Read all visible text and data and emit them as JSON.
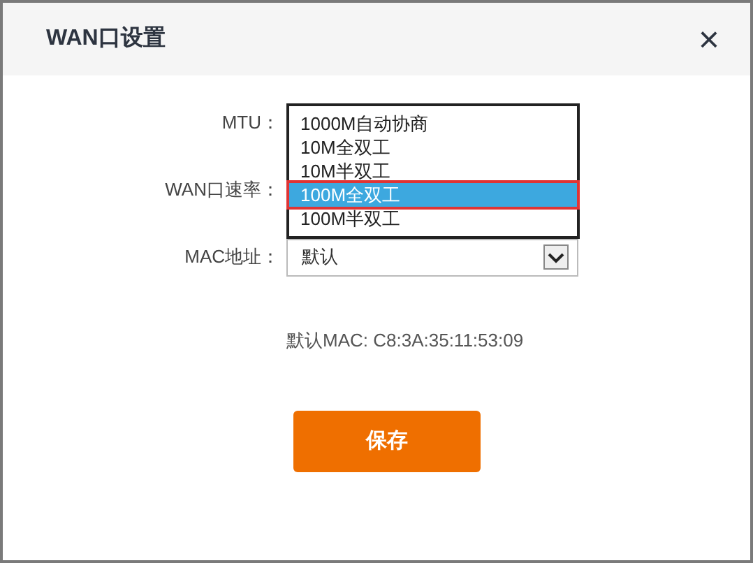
{
  "window": {
    "title": "WAN口设置",
    "close": "×"
  },
  "fields": [
    {
      "label": "MTU：",
      "kind": "covered"
    },
    {
      "label": "WAN口速率：",
      "kind": "covered"
    },
    {
      "label": "MAC地址：",
      "kind": "select",
      "value": "默认"
    }
  ],
  "dropdown": {
    "options": [
      {
        "label": "1000M自动协商",
        "selected": false,
        "marked": false
      },
      {
        "label": "10M全双工",
        "selected": false,
        "marked": false
      },
      {
        "label": "10M半双工",
        "selected": false,
        "marked": false
      },
      {
        "label": "100M全双工",
        "selected": true,
        "marked": true
      },
      {
        "label": "100M半双工",
        "selected": false,
        "marked": false
      }
    ]
  },
  "default_mac": "默认MAC: C8:3A:35:11:53:09",
  "buttons": [
    "保存"
  ]
}
